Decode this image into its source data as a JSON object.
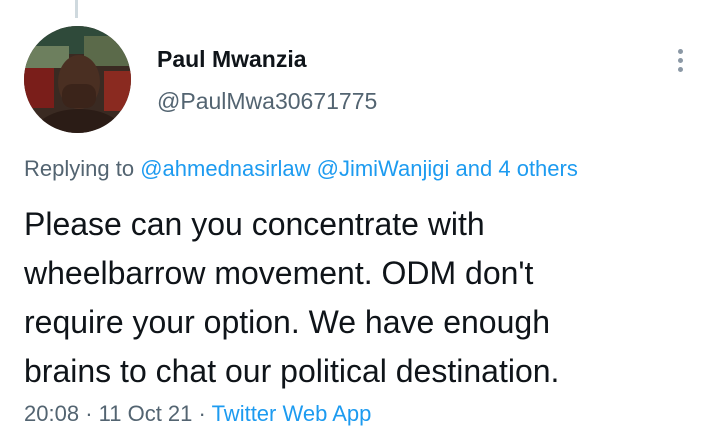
{
  "author": {
    "name": "Paul Mwanzia",
    "handle": "@PaulMwa30671775"
  },
  "reply": {
    "prefix": "Replying to",
    "mention1": "@ahmednasirlaw",
    "mention2": "@JimiWanjigi",
    "and_text": "and",
    "others": "4 others"
  },
  "tweet": {
    "lines": [
      "Please can you concentrate with",
      "wheelbarrow movement. ODM don't",
      "require your option. We have enough",
      "brains to chat our political destination."
    ]
  },
  "meta": {
    "time": "20:08",
    "separator": "·",
    "date": "11 Oct 21",
    "source": "Twitter Web App"
  },
  "icons": {
    "more": "more-options-icon",
    "avatar": "profile-avatar"
  },
  "colors": {
    "link": "#1d9bf0",
    "secondary": "#536471",
    "primary": "#0f1419"
  }
}
